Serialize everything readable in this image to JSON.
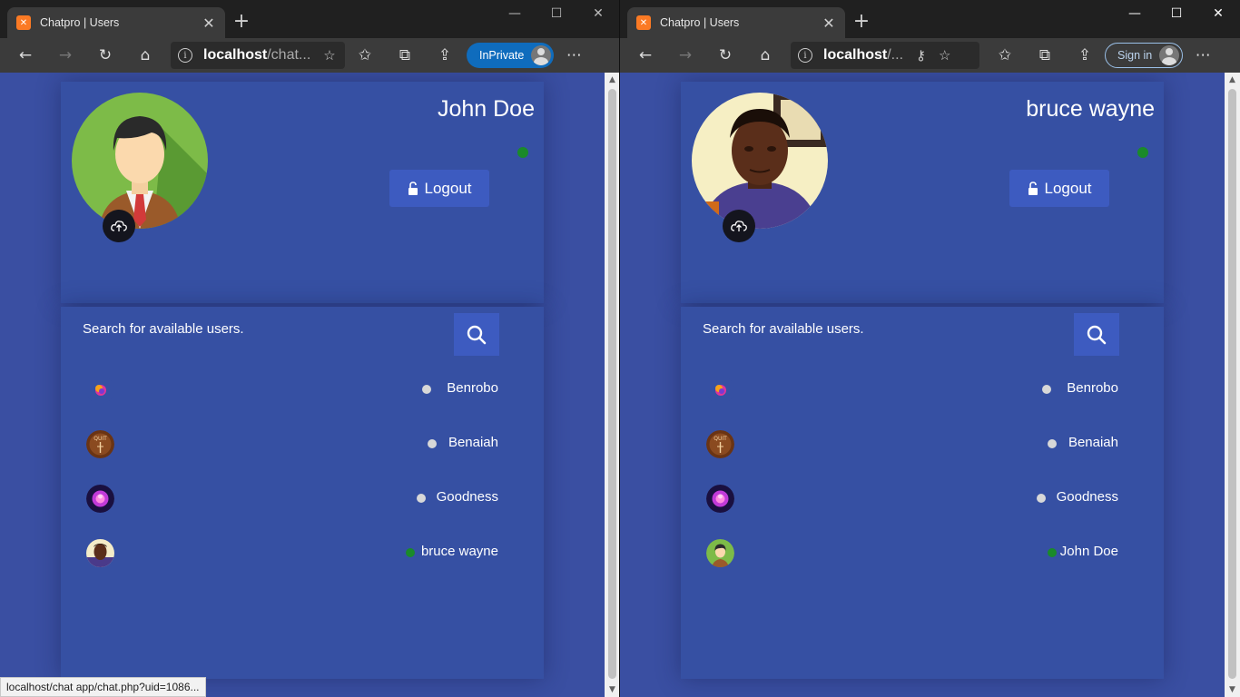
{
  "colors": {
    "page_bg": "#3a4fa2",
    "card_bg": "#3650a3",
    "button_bg": "#3d5bc0",
    "online": "#1a8a2a",
    "offline": "#d8d8d8",
    "chrome_dark": "#202020",
    "chrome_toolbar": "#3b3b3b"
  },
  "left_window": {
    "tab_title": "Chatpro | Users",
    "address_host": "localhost",
    "address_path": "/chat...",
    "profile_badge": "InPrivate",
    "profile": {
      "name": "John Doe",
      "status": "online",
      "logout_label": "Logout",
      "avatar": "john-doe-avatar"
    },
    "search_label": "Search for available users.",
    "users": [
      {
        "name": "Benrobo",
        "status": "offline",
        "avatar": "benrobo-avatar"
      },
      {
        "name": "Benaiah",
        "status": "offline",
        "avatar": "benaiah-avatar"
      },
      {
        "name": "Goodness",
        "status": "offline",
        "avatar": "goodness-avatar"
      },
      {
        "name": "bruce wayne",
        "status": "online",
        "avatar": "bruce-wayne-avatar"
      }
    ],
    "status_url": "localhost/chat app/chat.php?uid=1086..."
  },
  "right_window": {
    "tab_title": "Chatpro | Users",
    "address_host": "localhost",
    "address_path": "/...",
    "profile_badge": "Sign in",
    "profile": {
      "name": "bruce wayne",
      "status": "online",
      "logout_label": "Logout",
      "avatar": "bruce-wayne-avatar"
    },
    "search_label": "Search for available users.",
    "users": [
      {
        "name": "Benrobo",
        "status": "offline",
        "avatar": "benrobo-avatar"
      },
      {
        "name": "Benaiah",
        "status": "offline",
        "avatar": "benaiah-avatar"
      },
      {
        "name": "Goodness",
        "status": "offline",
        "avatar": "goodness-avatar"
      },
      {
        "name": "John Doe",
        "status": "online",
        "avatar": "john-doe-avatar"
      }
    ]
  }
}
